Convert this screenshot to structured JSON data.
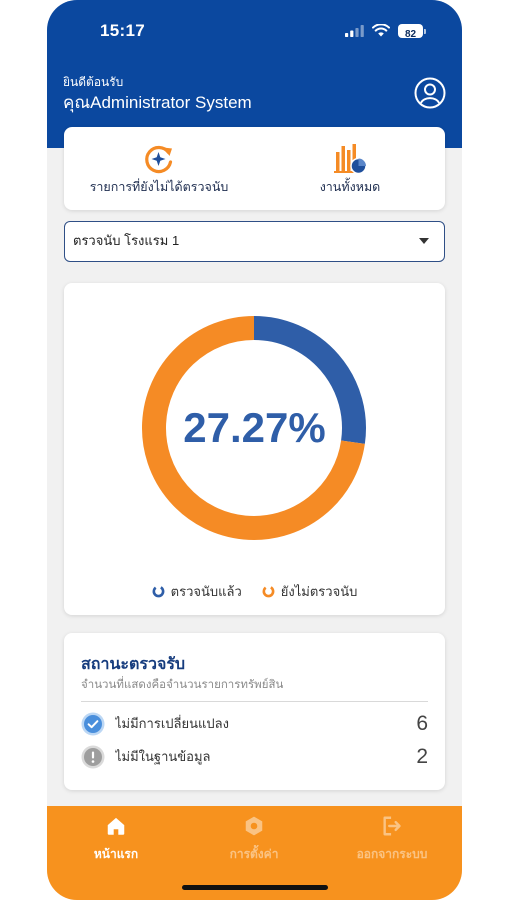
{
  "status_bar": {
    "time": "15:17",
    "battery_level": "82",
    "signal_icon": "cellular-signal-icon",
    "wifi_icon": "wifi-icon",
    "battery_icon": "battery-icon"
  },
  "header": {
    "greeting": "ยินดีต้อนรับ",
    "user_name": "คุณAdministrator System",
    "profile_icon": "user-circle-icon"
  },
  "quick_actions": [
    {
      "label": "รายการที่ยังไม่ได้ตรวจนับ",
      "icon": "sync-progress-icon"
    },
    {
      "label": "งานทั้งหมด",
      "icon": "bar-chart-pie-icon"
    }
  ],
  "audit_selector": {
    "selected": "ตรวจนับ โรงแรม 1",
    "icon": "caret-down-icon"
  },
  "chart_data": {
    "type": "pie",
    "donut": true,
    "categories": [
      "ตรวจนับแล้ว",
      "ยังไม่ตรวจนับ"
    ],
    "values": [
      27.27,
      72.73
    ],
    "center_label": "27.27%",
    "colors": [
      "#2f5ea8",
      "#f58b25"
    ],
    "legend": "bottom"
  },
  "status_card": {
    "title": "สถานะตรวจรับ",
    "subtitle": "จำนวนที่แสดงคือจำนวนรายการทรัพย์สิน",
    "rows": [
      {
        "label": "ไม่มีการเปลี่ยนแปลง",
        "count": "6",
        "icon": "check-circle-icon",
        "color": "#4a8fdc"
      },
      {
        "label": "ไม่มีในฐานข้อมูล",
        "count": "2",
        "icon": "alert-circle-icon",
        "color": "#9e9e9e"
      }
    ]
  },
  "bottom_nav": {
    "items": [
      {
        "label": "หน้าแรก",
        "icon": "home-icon",
        "active": true
      },
      {
        "label": "การตั้งค่า",
        "icon": "settings-icon",
        "active": false
      },
      {
        "label": "ออกจากระบบ",
        "icon": "logout-icon",
        "active": false
      }
    ]
  },
  "colors": {
    "primary": "#0b489f",
    "accent": "#f7921e",
    "background": "#f1f1f1"
  }
}
